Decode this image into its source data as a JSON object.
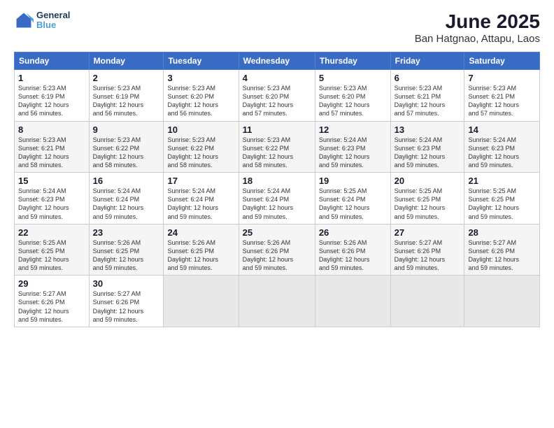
{
  "logo": {
    "line1": "General",
    "line2": "Blue"
  },
  "title": "June 2025",
  "subtitle": "Ban Hatgnao, Attapu, Laos",
  "headers": [
    "Sunday",
    "Monday",
    "Tuesday",
    "Wednesday",
    "Thursday",
    "Friday",
    "Saturday"
  ],
  "weeks": [
    [
      {
        "day": "1",
        "detail": "Sunrise: 5:23 AM\nSunset: 6:19 PM\nDaylight: 12 hours\nand 56 minutes."
      },
      {
        "day": "2",
        "detail": "Sunrise: 5:23 AM\nSunset: 6:19 PM\nDaylight: 12 hours\nand 56 minutes."
      },
      {
        "day": "3",
        "detail": "Sunrise: 5:23 AM\nSunset: 6:20 PM\nDaylight: 12 hours\nand 56 minutes."
      },
      {
        "day": "4",
        "detail": "Sunrise: 5:23 AM\nSunset: 6:20 PM\nDaylight: 12 hours\nand 57 minutes."
      },
      {
        "day": "5",
        "detail": "Sunrise: 5:23 AM\nSunset: 6:20 PM\nDaylight: 12 hours\nand 57 minutes."
      },
      {
        "day": "6",
        "detail": "Sunrise: 5:23 AM\nSunset: 6:21 PM\nDaylight: 12 hours\nand 57 minutes."
      },
      {
        "day": "7",
        "detail": "Sunrise: 5:23 AM\nSunset: 6:21 PM\nDaylight: 12 hours\nand 57 minutes."
      }
    ],
    [
      {
        "day": "8",
        "detail": "Sunrise: 5:23 AM\nSunset: 6:21 PM\nDaylight: 12 hours\nand 58 minutes."
      },
      {
        "day": "9",
        "detail": "Sunrise: 5:23 AM\nSunset: 6:22 PM\nDaylight: 12 hours\nand 58 minutes."
      },
      {
        "day": "10",
        "detail": "Sunrise: 5:23 AM\nSunset: 6:22 PM\nDaylight: 12 hours\nand 58 minutes."
      },
      {
        "day": "11",
        "detail": "Sunrise: 5:23 AM\nSunset: 6:22 PM\nDaylight: 12 hours\nand 58 minutes."
      },
      {
        "day": "12",
        "detail": "Sunrise: 5:24 AM\nSunset: 6:23 PM\nDaylight: 12 hours\nand 59 minutes."
      },
      {
        "day": "13",
        "detail": "Sunrise: 5:24 AM\nSunset: 6:23 PM\nDaylight: 12 hours\nand 59 minutes."
      },
      {
        "day": "14",
        "detail": "Sunrise: 5:24 AM\nSunset: 6:23 PM\nDaylight: 12 hours\nand 59 minutes."
      }
    ],
    [
      {
        "day": "15",
        "detail": "Sunrise: 5:24 AM\nSunset: 6:23 PM\nDaylight: 12 hours\nand 59 minutes."
      },
      {
        "day": "16",
        "detail": "Sunrise: 5:24 AM\nSunset: 6:24 PM\nDaylight: 12 hours\nand 59 minutes."
      },
      {
        "day": "17",
        "detail": "Sunrise: 5:24 AM\nSunset: 6:24 PM\nDaylight: 12 hours\nand 59 minutes."
      },
      {
        "day": "18",
        "detail": "Sunrise: 5:24 AM\nSunset: 6:24 PM\nDaylight: 12 hours\nand 59 minutes."
      },
      {
        "day": "19",
        "detail": "Sunrise: 5:25 AM\nSunset: 6:24 PM\nDaylight: 12 hours\nand 59 minutes."
      },
      {
        "day": "20",
        "detail": "Sunrise: 5:25 AM\nSunset: 6:25 PM\nDaylight: 12 hours\nand 59 minutes."
      },
      {
        "day": "21",
        "detail": "Sunrise: 5:25 AM\nSunset: 6:25 PM\nDaylight: 12 hours\nand 59 minutes."
      }
    ],
    [
      {
        "day": "22",
        "detail": "Sunrise: 5:25 AM\nSunset: 6:25 PM\nDaylight: 12 hours\nand 59 minutes."
      },
      {
        "day": "23",
        "detail": "Sunrise: 5:26 AM\nSunset: 6:25 PM\nDaylight: 12 hours\nand 59 minutes."
      },
      {
        "day": "24",
        "detail": "Sunrise: 5:26 AM\nSunset: 6:25 PM\nDaylight: 12 hours\nand 59 minutes."
      },
      {
        "day": "25",
        "detail": "Sunrise: 5:26 AM\nSunset: 6:26 PM\nDaylight: 12 hours\nand 59 minutes."
      },
      {
        "day": "26",
        "detail": "Sunrise: 5:26 AM\nSunset: 6:26 PM\nDaylight: 12 hours\nand 59 minutes."
      },
      {
        "day": "27",
        "detail": "Sunrise: 5:27 AM\nSunset: 6:26 PM\nDaylight: 12 hours\nand 59 minutes."
      },
      {
        "day": "28",
        "detail": "Sunrise: 5:27 AM\nSunset: 6:26 PM\nDaylight: 12 hours\nand 59 minutes."
      }
    ],
    [
      {
        "day": "29",
        "detail": "Sunrise: 5:27 AM\nSunset: 6:26 PM\nDaylight: 12 hours\nand 59 minutes."
      },
      {
        "day": "30",
        "detail": "Sunrise: 5:27 AM\nSunset: 6:26 PM\nDaylight: 12 hours\nand 59 minutes."
      },
      {
        "day": "",
        "detail": ""
      },
      {
        "day": "",
        "detail": ""
      },
      {
        "day": "",
        "detail": ""
      },
      {
        "day": "",
        "detail": ""
      },
      {
        "day": "",
        "detail": ""
      }
    ]
  ]
}
